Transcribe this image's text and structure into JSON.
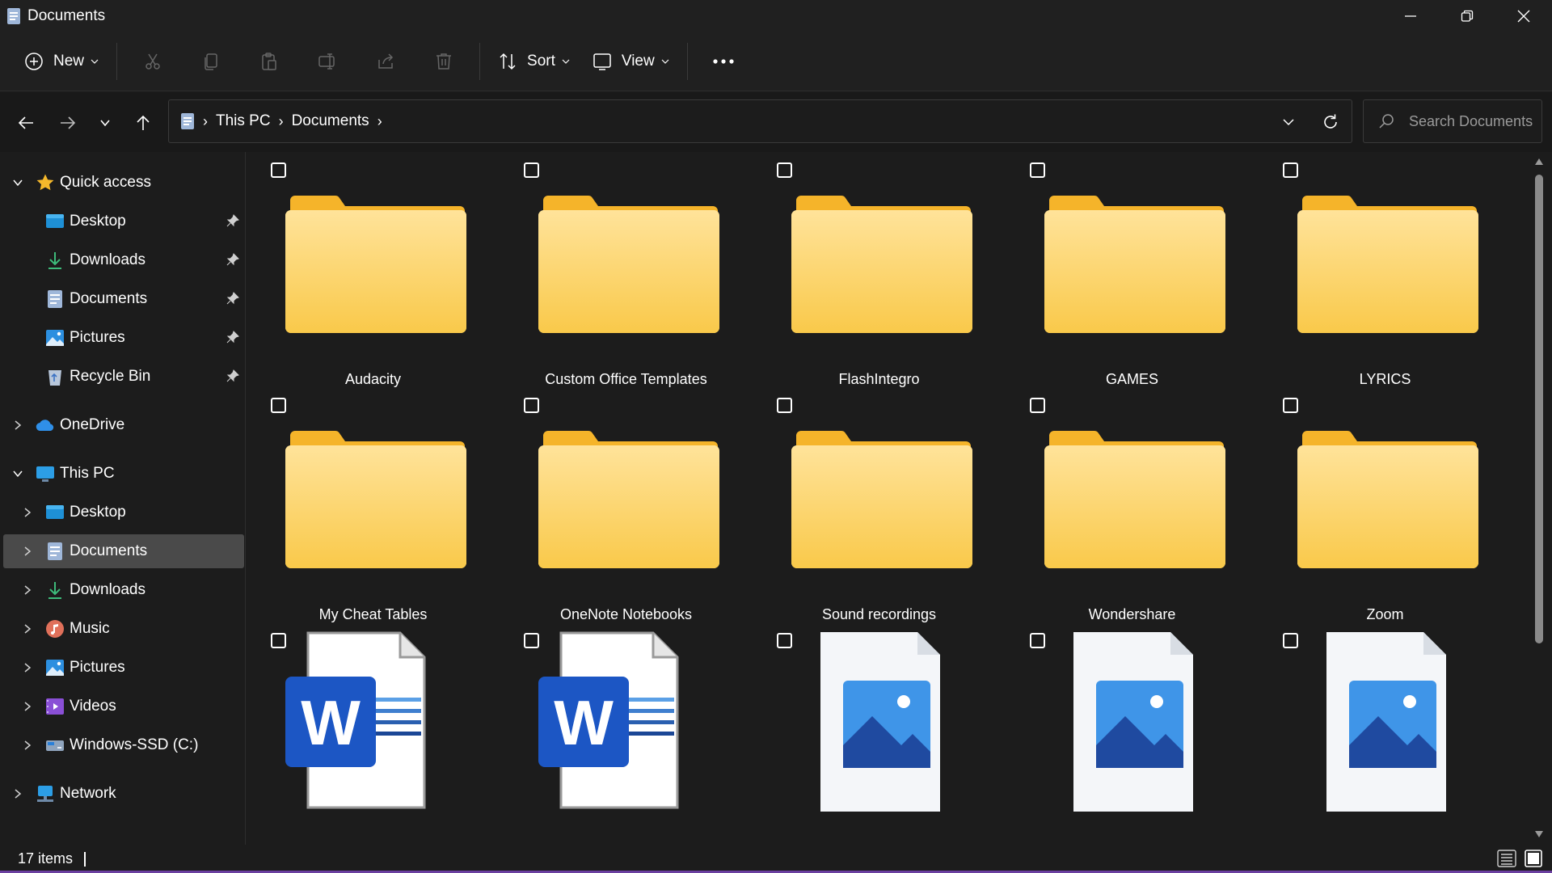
{
  "window": {
    "title": "Documents"
  },
  "toolbar": {
    "new_label": "New",
    "sort_label": "Sort",
    "view_label": "View"
  },
  "address": {
    "root_label": "This PC",
    "current_label": "Documents"
  },
  "search": {
    "placeholder": "Search Documents"
  },
  "sidebar": {
    "quick_access": "Quick access",
    "quick_items": [
      "Desktop",
      "Downloads",
      "Documents",
      "Pictures",
      "Recycle Bin"
    ],
    "onedrive": "OneDrive",
    "this_pc": "This PC",
    "pc_items": [
      "Desktop",
      "Documents",
      "Downloads",
      "Music",
      "Pictures",
      "Videos",
      "Windows-SSD (C:)"
    ],
    "network": "Network",
    "selected": "Documents"
  },
  "files": [
    {
      "name": "Audacity",
      "type": "folder"
    },
    {
      "name": "Custom Office Templates",
      "type": "folder"
    },
    {
      "name": "FlashIntegro",
      "type": "folder"
    },
    {
      "name": "GAMES",
      "type": "folder"
    },
    {
      "name": "LYRICS",
      "type": "folder"
    },
    {
      "name": "My Cheat Tables",
      "type": "folder"
    },
    {
      "name": "OneNote Notebooks",
      "type": "folder"
    },
    {
      "name": "Sound recordings",
      "type": "folder"
    },
    {
      "name": "Wondershare",
      "type": "folder"
    },
    {
      "name": "Zoom",
      "type": "folder"
    },
    {
      "name": "",
      "type": "word"
    },
    {
      "name": "",
      "type": "word"
    },
    {
      "name": "",
      "type": "image"
    },
    {
      "name": "",
      "type": "image"
    },
    {
      "name": "",
      "type": "image"
    }
  ],
  "status": {
    "count_label": "17 items"
  }
}
